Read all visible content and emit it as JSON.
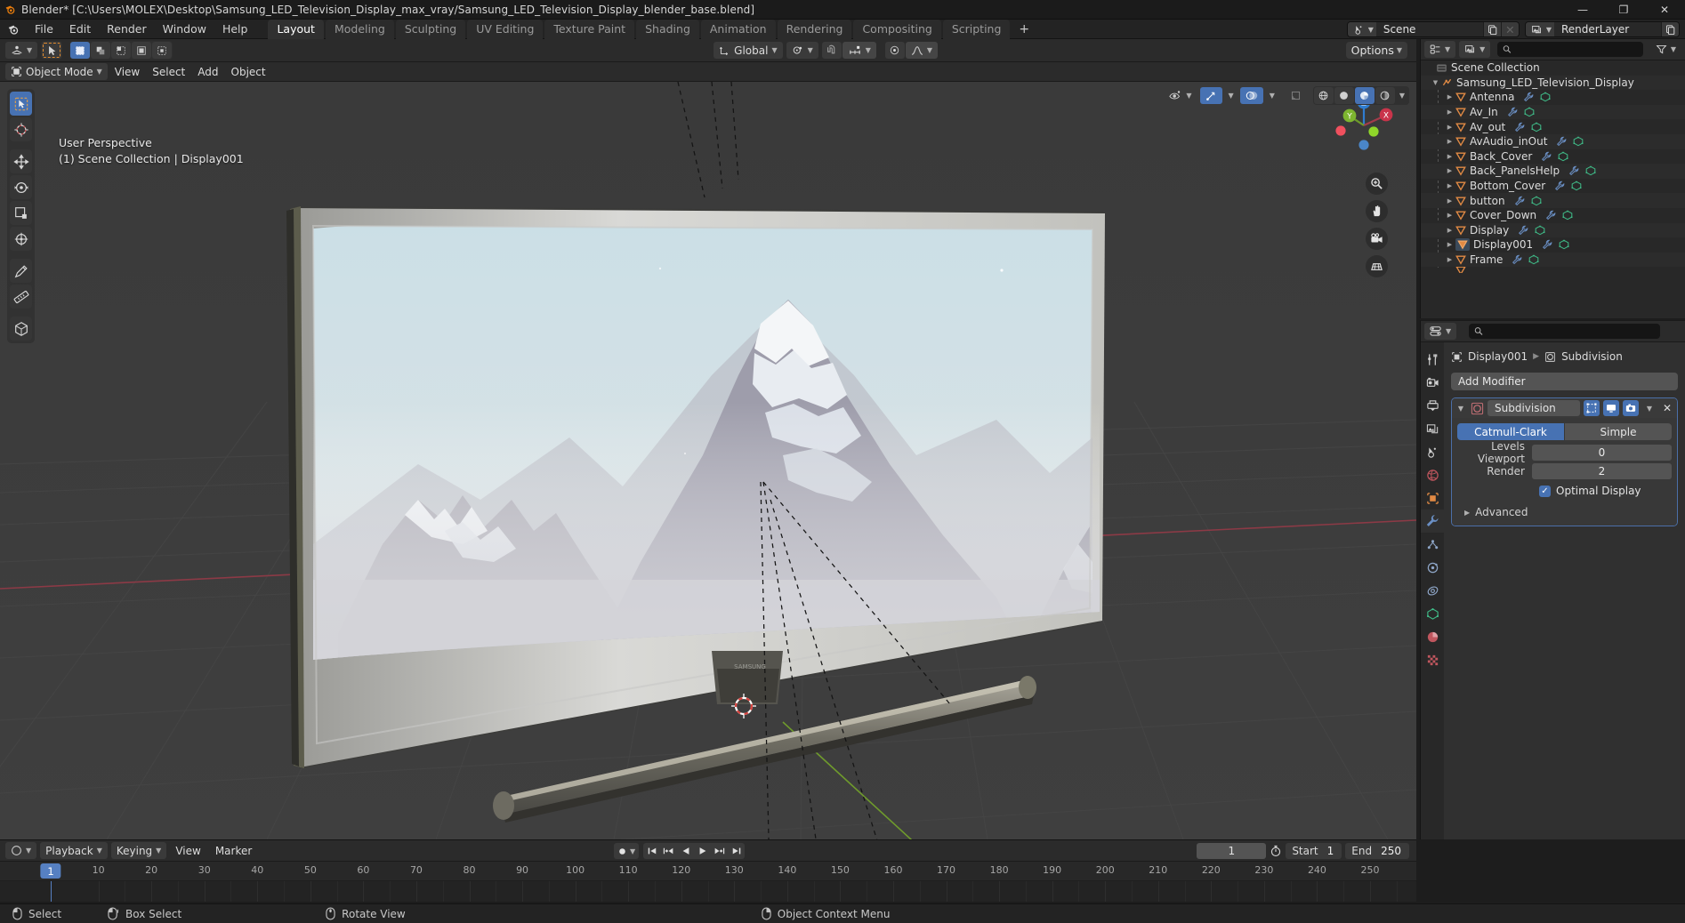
{
  "window": {
    "title": "Blender* [C:\\Users\\MOLEX\\Desktop\\Samsung_LED_Television_Display_max_vray/Samsung_LED_Television_Display_blender_base.blend]",
    "minimize": "—",
    "maximize": "❐",
    "close": "✕"
  },
  "menu": {
    "items": [
      "File",
      "Edit",
      "Render",
      "Window",
      "Help"
    ]
  },
  "workspace_tabs": [
    {
      "label": "Layout",
      "active": true
    },
    {
      "label": "Modeling",
      "active": false
    },
    {
      "label": "Sculpting",
      "active": false
    },
    {
      "label": "UV Editing",
      "active": false
    },
    {
      "label": "Texture Paint",
      "active": false
    },
    {
      "label": "Shading",
      "active": false
    },
    {
      "label": "Animation",
      "active": false
    },
    {
      "label": "Rendering",
      "active": false
    },
    {
      "label": "Compositing",
      "active": false
    },
    {
      "label": "Scripting",
      "active": false
    },
    {
      "label": "+",
      "active": false
    }
  ],
  "topbar_right": {
    "scene_name": "Scene",
    "view_layer_name": "RenderLayer"
  },
  "viewport": {
    "mode": "Object Mode",
    "menus": [
      "View",
      "Select",
      "Add",
      "Object"
    ],
    "transform_orientation": "Global",
    "options_label": "Options",
    "overlay_line1": "User Perspective",
    "overlay_line2": "(1) Scene Collection | Display001",
    "gizmo_axes": [
      "X",
      "Y",
      "Z"
    ],
    "tools": [
      "tweak-select-tool",
      "cursor-tool",
      "move-tool",
      "rotate-tool",
      "scale-tool",
      "transform-tool",
      "annotate-tool",
      "measure-tool",
      "add-cube-tool"
    ],
    "nav_buttons": [
      "zoom-nav",
      "pan-nav",
      "camera-nav",
      "ortho-toggle-nav"
    ]
  },
  "outliner": {
    "search_placeholder": "",
    "root": "Scene Collection",
    "items": [
      {
        "label": "Samsung_LED_Television_Display",
        "depth": 0,
        "type": "armature",
        "expanded": true,
        "selected": false
      },
      {
        "label": "Antenna",
        "depth": 1,
        "type": "mesh",
        "selected": false
      },
      {
        "label": "Av_In",
        "depth": 1,
        "type": "mesh",
        "selected": false
      },
      {
        "label": "Av_out",
        "depth": 1,
        "type": "mesh",
        "selected": false
      },
      {
        "label": "AvAudio_inOut",
        "depth": 1,
        "type": "mesh",
        "selected": false
      },
      {
        "label": "Back_Cover",
        "depth": 1,
        "type": "mesh",
        "selected": false
      },
      {
        "label": "Back_PanelsHelp",
        "depth": 1,
        "type": "mesh",
        "selected": false
      },
      {
        "label": "Bottom_Cover",
        "depth": 1,
        "type": "mesh",
        "selected": false
      },
      {
        "label": "button",
        "depth": 1,
        "type": "mesh",
        "selected": false
      },
      {
        "label": "Cover_Down",
        "depth": 1,
        "type": "mesh",
        "selected": false
      },
      {
        "label": "Display",
        "depth": 1,
        "type": "mesh",
        "selected": false
      },
      {
        "label": "Display001",
        "depth": 1,
        "type": "mesh",
        "selected": true
      },
      {
        "label": "Frame",
        "depth": 1,
        "type": "mesh",
        "selected": false
      }
    ]
  },
  "properties": {
    "search_placeholder": "",
    "breadcrumb_object": "Display001",
    "breadcrumb_modifier": "Subdivision",
    "add_modifier_label": "Add Modifier",
    "modifier": {
      "name": "Subdivision",
      "type_options": [
        "Catmull-Clark",
        "Simple"
      ],
      "type_selected": "Catmull-Clark",
      "fields": [
        {
          "label": "Levels Viewport",
          "value": "0"
        },
        {
          "label": "Render",
          "value": "2"
        }
      ],
      "optimal_display_label": "Optimal Display",
      "optimal_display_checked": true,
      "advanced_label": "Advanced"
    },
    "tabs": [
      "tool-tab",
      "render-tab",
      "output-tab",
      "view-layer-tab",
      "scene-tab",
      "world-tab",
      "object-tab",
      "modifier-tab",
      "particles-tab",
      "physics-tab",
      "constraints-tab",
      "data-tab",
      "material-tab",
      "texture-tab"
    ],
    "active_tab": "modifier-tab"
  },
  "timeline": {
    "menus": [
      "Playback",
      "Keying",
      "View",
      "Marker"
    ],
    "current_frame": "1",
    "start_label": "Start",
    "start_value": "1",
    "end_label": "End",
    "end_value": "250",
    "ticks": [
      1,
      10,
      20,
      30,
      40,
      50,
      60,
      70,
      80,
      90,
      100,
      110,
      120,
      130,
      140,
      150,
      160,
      170,
      180,
      190,
      200,
      210,
      220,
      230,
      240,
      250
    ],
    "playhead_frame": 1
  },
  "statusbar": {
    "items": [
      {
        "icon": "mouse-left-icon",
        "label": "Select"
      },
      {
        "icon": "mouse-drag-icon",
        "label": "Box Select"
      },
      {
        "icon": "mouse-middle-icon",
        "label": "Rotate View"
      },
      {
        "icon": "mouse-right-icon",
        "label": "Object Context Menu"
      }
    ]
  },
  "colors": {
    "accent_blue": "#4772b3",
    "mesh_orange": "#e18a44",
    "modifier_blue": "#6a8fc4",
    "mesh_data_green": "#3fba87",
    "axis_x": "#c9344a",
    "axis_y": "#7db52f",
    "axis_z": "#2f7dd1",
    "bg_dark": "#282828",
    "bg_panel": "#303030",
    "viewport_bg": "#3c3c3c"
  }
}
